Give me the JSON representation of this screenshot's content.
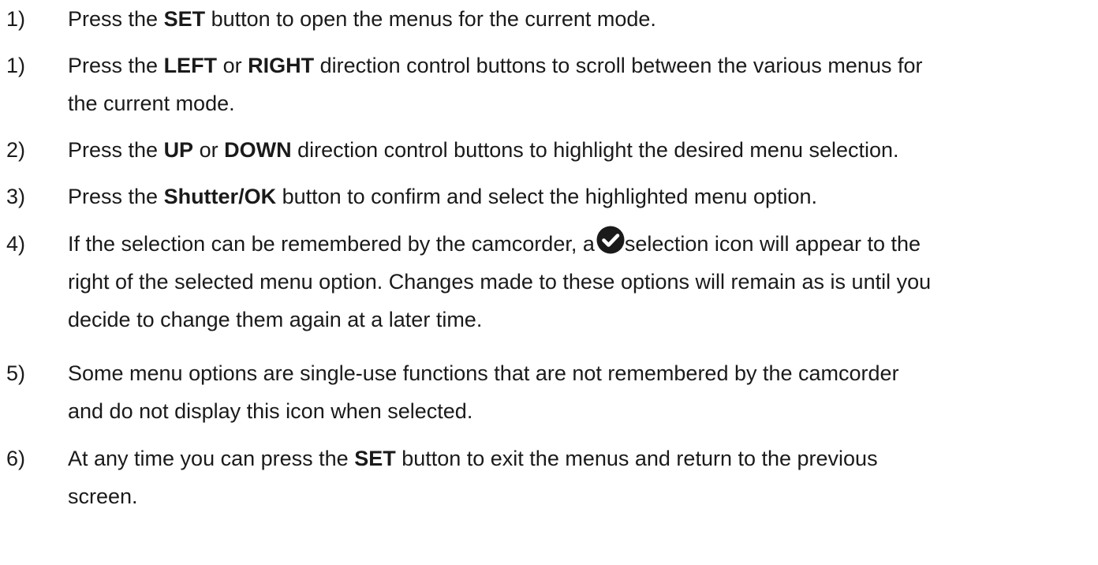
{
  "steps": [
    {
      "number": "1)",
      "lines": [
        [
          "Press the ",
          "SET",
          " button to open the menus for the current mode."
        ]
      ]
    },
    {
      "number": "1)",
      "lines": [
        [
          "Press the ",
          "LEFT",
          " or ",
          "RIGHT",
          " direction control buttons to scroll between the various menus for"
        ],
        [
          "the current mode."
        ]
      ]
    },
    {
      "number": "2)",
      "lines": [
        [
          "Press the ",
          "UP",
          " or ",
          "DOWN",
          " direction control buttons to highlight the desired menu selection."
        ]
      ]
    },
    {
      "number": "3)",
      "lines": [
        [
          "Press the ",
          "Shutter/OK",
          " button to confirm and select the highlighted menu option."
        ]
      ]
    },
    {
      "number": "4)",
      "lines": [
        [
          "If the selection can be remembered by the camcorder, a",
          "selection icon will appear to the"
        ],
        [
          "right of the selected menu option. Changes made to these options will remain as is until you"
        ],
        [
          "decide to change them again at a later time."
        ]
      ]
    },
    {
      "number": "5)",
      "lines": [
        [
          "Some menu options are single-use functions that are not remembered by the camcorder"
        ],
        [
          "and do not display this icon when selected."
        ]
      ]
    },
    {
      "number": "6)",
      "lines": [
        [
          "At any time you can press the ",
          "SET",
          " button to exit the menus and return to the previous"
        ],
        [
          "screen."
        ]
      ]
    }
  ],
  "icons": {
    "selection_icon": "check-circle-icon"
  },
  "colors": {
    "text": "#1a1a1a",
    "icon_fill": "#1a1a1a",
    "icon_check": "#ffffff",
    "background": "#ffffff"
  }
}
